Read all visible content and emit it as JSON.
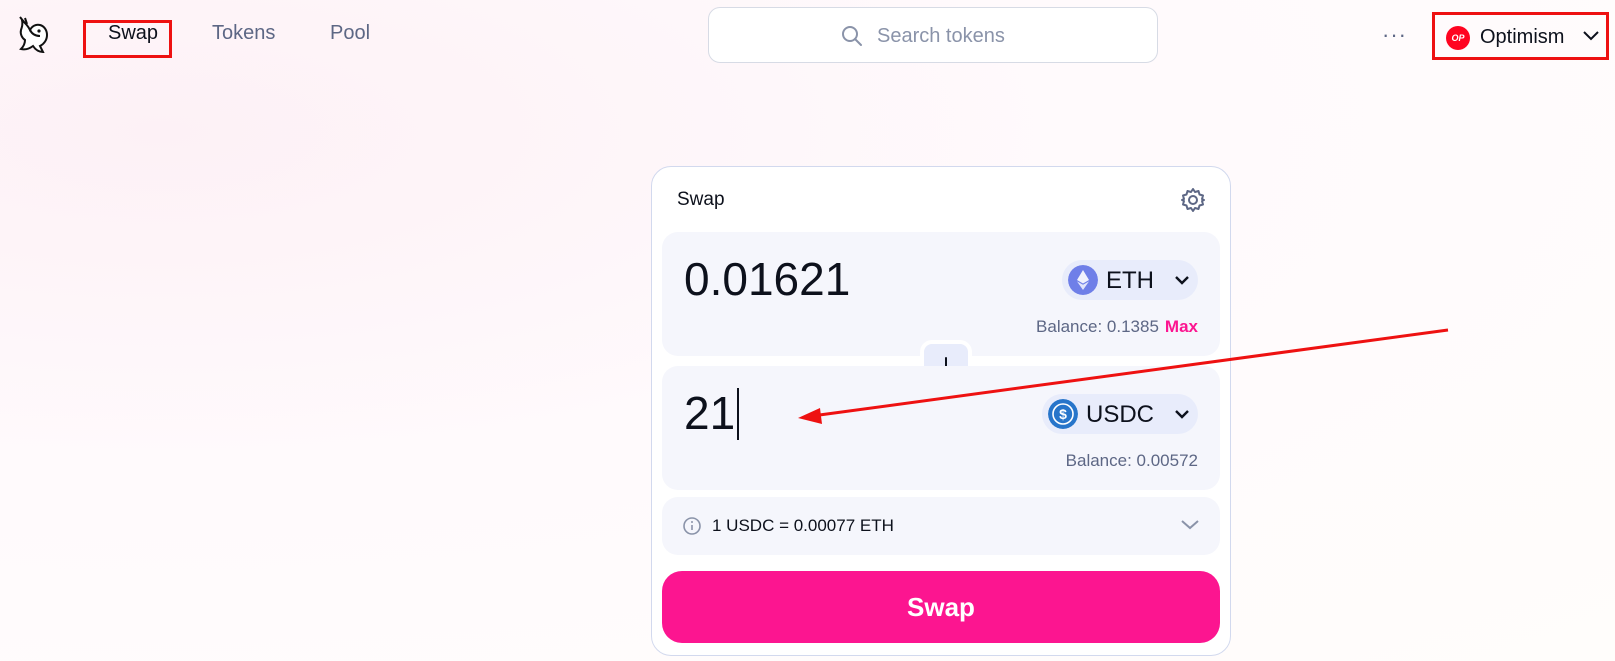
{
  "nav": {
    "links": [
      {
        "label": "Swap",
        "active": true
      },
      {
        "label": "Tokens",
        "active": false
      },
      {
        "label": "Pool",
        "active": false
      }
    ],
    "search_placeholder": "Search tokens",
    "more_label": "···",
    "network": {
      "label": "Optimism",
      "badge": "OP",
      "color": "#ff0420"
    }
  },
  "swap_card": {
    "title": "Swap",
    "input": {
      "amount": "0.01621",
      "token": "ETH",
      "balance_label": "Balance: 0.1385",
      "max_label": "Max"
    },
    "output": {
      "amount": "21",
      "token": "USDC",
      "balance_label": "Balance: 0.00572"
    },
    "rate_text": "1 USDC = 0.00077 ETH",
    "submit_label": "Swap"
  },
  "colors": {
    "accent": "#fc1590",
    "annotation": "#ee1111"
  }
}
